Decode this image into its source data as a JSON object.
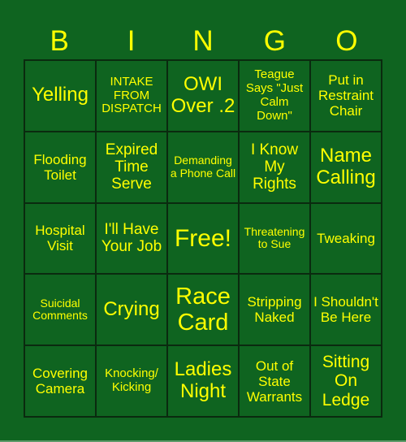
{
  "header": [
    "B",
    "I",
    "N",
    "G",
    "O"
  ],
  "colors": {
    "background": "#0f6420",
    "text": "#ffff00",
    "border": "#0a2a0f"
  },
  "cells": [
    [
      "Yelling",
      "INTAKE FROM DISPATCH",
      "OWI Over .2",
      "Teague Says \"Just Calm Down\"",
      "Put in Restraint Chair"
    ],
    [
      "Flooding Toilet",
      "Expired Time Serve",
      "Demanding a Phone Call",
      "I Know My Rights",
      "Name Calling"
    ],
    [
      "Hospital Visit",
      "I'll Have Your Job",
      "Free!",
      "Threatening to Sue",
      "Tweaking"
    ],
    [
      "Suicidal Comments",
      "Crying",
      "Race Card",
      "Stripping Naked",
      "I Shouldn't Be Here"
    ],
    [
      "Covering Camera",
      "Knocking/ Kicking",
      "Ladies Night",
      "Out of State Warrants",
      "Sitting On Ledge"
    ]
  ]
}
